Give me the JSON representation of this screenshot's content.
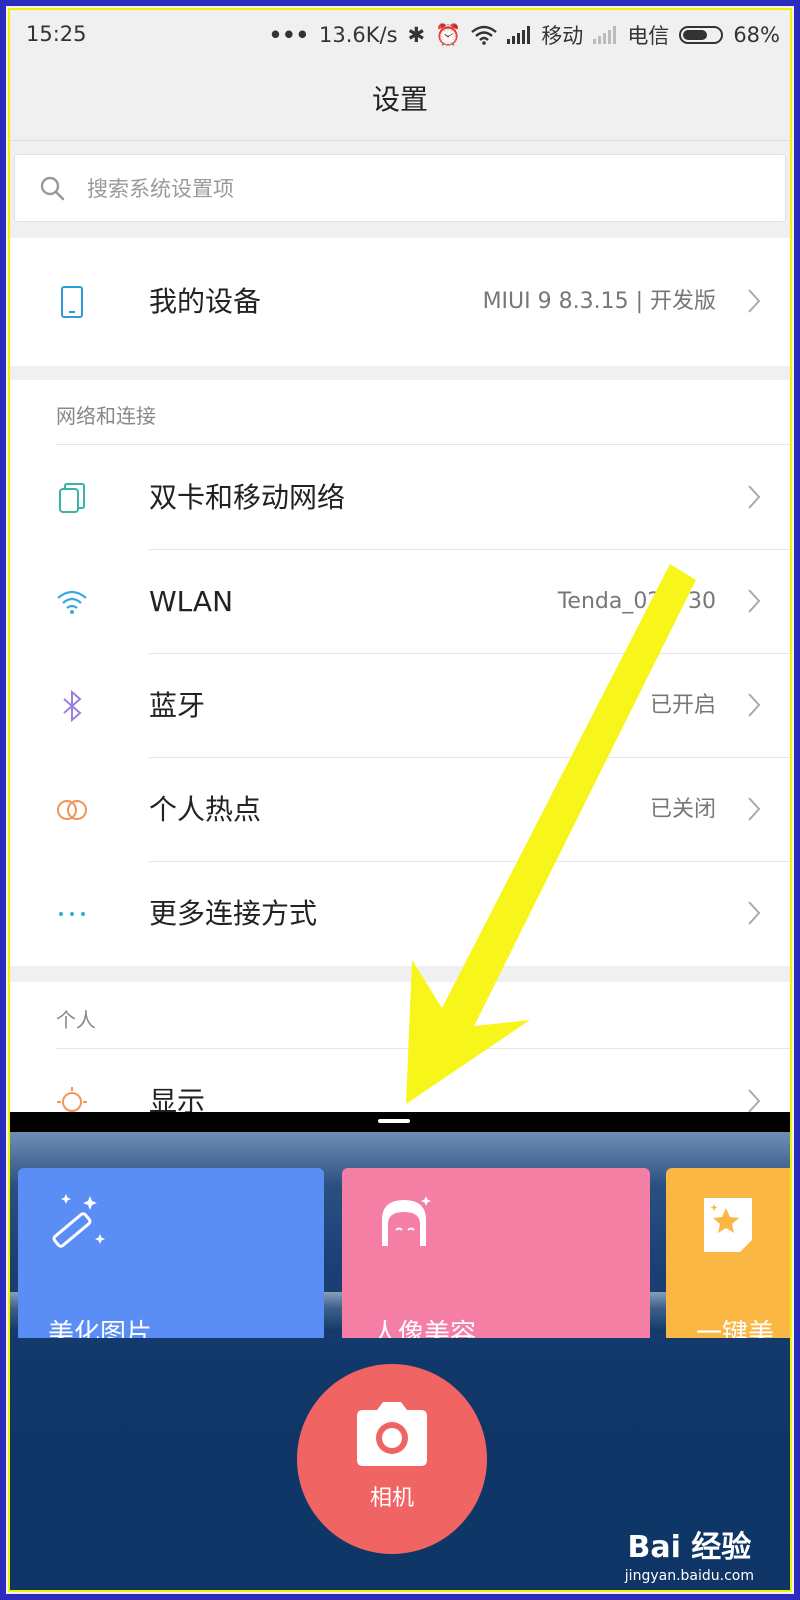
{
  "status": {
    "time": "15:25",
    "speed": "13.6K/s",
    "carrier1": "移动",
    "carrier2": "电信",
    "battery": "68%",
    "battery_level": 0.68
  },
  "title": "设置",
  "search": {
    "placeholder": "搜索系统设置项"
  },
  "device": {
    "label": "我的设备",
    "value": "MIUI 9 8.3.15 | 开发版"
  },
  "network": {
    "header": "网络和连接",
    "items": [
      {
        "label": "双卡和移动网络",
        "value": ""
      },
      {
        "label": "WLAN",
        "value": "Tenda_025F30"
      },
      {
        "label": "蓝牙",
        "value": "已开启"
      },
      {
        "label": "个人热点",
        "value": "已关闭"
      },
      {
        "label": "更多连接方式",
        "value": ""
      }
    ]
  },
  "personal": {
    "header": "个人",
    "items": [
      {
        "label": "显示",
        "value": ""
      }
    ]
  },
  "apps": {
    "tiles": [
      {
        "label": "美化图片",
        "color": "#5b8ef5"
      },
      {
        "label": "人像美容",
        "color": "#f47ea4"
      },
      {
        "label": "一键美",
        "color": "#fbb744"
      }
    ],
    "camera": {
      "label": "相机",
      "color": "#f06563"
    }
  },
  "watermark": {
    "brand": "Bai 经验",
    "url": "jingyan.baidu.com"
  },
  "colors": {
    "annotation_arrow": "#f8f51a"
  }
}
